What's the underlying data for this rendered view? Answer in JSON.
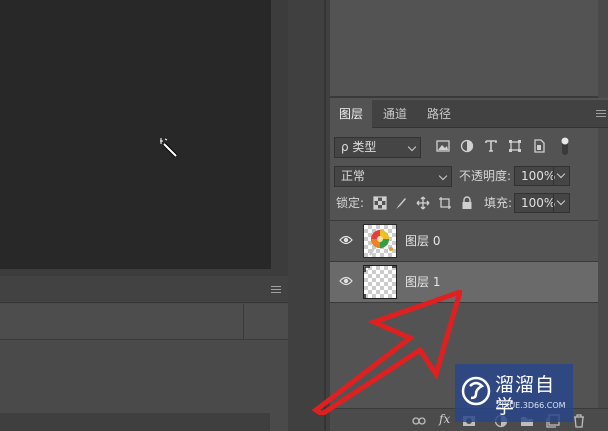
{
  "layers_panel": {
    "tabs": [
      {
        "label": "图层"
      },
      {
        "label": "通道"
      },
      {
        "label": "路径"
      }
    ],
    "filter": {
      "value": "ρ 类型"
    },
    "blend_mode": {
      "value": "正常"
    },
    "opacity": {
      "label": "不透明度:",
      "value": "100%"
    },
    "lock": {
      "label": "锁定:"
    },
    "fill": {
      "label": "填充:",
      "value": "100%"
    },
    "layers": [
      {
        "name": "图层 0",
        "thumbnail": "image"
      },
      {
        "name": "图层 1",
        "thumbnail": "transparent"
      }
    ],
    "bottom_fx": "fx"
  },
  "watermark": {
    "title": "溜溜自学",
    "subtitle": "ZIXUE.3D66.COM"
  }
}
